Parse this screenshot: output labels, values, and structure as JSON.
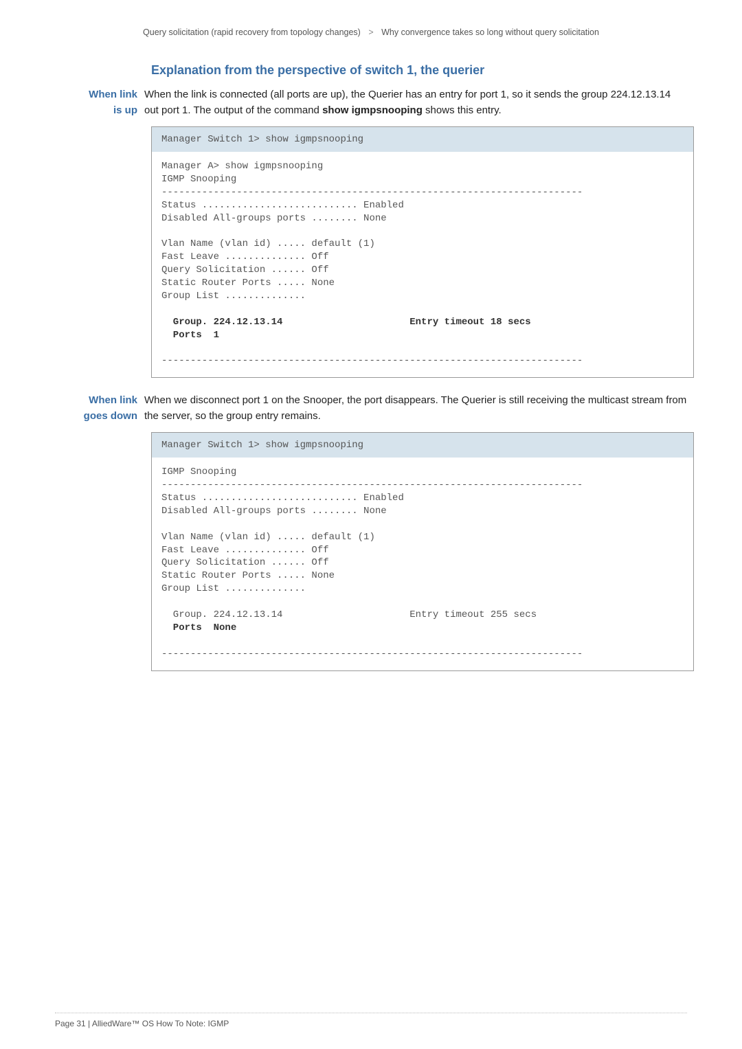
{
  "breadcrumb": {
    "left": "Query solicitation (rapid recovery from topology changes)",
    "right": "Why convergence takes so long without query solicitation"
  },
  "heading": "Explanation from the perspective of switch 1, the querier",
  "section1": {
    "side_l1": "When link",
    "side_l2": "is up",
    "para_a": "When the link is connected (all ports are up), the Querier has an entry for port 1, so it sends the group 224.12.13.14 out port 1. The output of the command ",
    "cmd": "show igmpsnooping",
    "para_b": " shows this entry."
  },
  "term1": {
    "header": "Manager Switch 1> show igmpsnooping",
    "l1": "Manager A> show igmpsnooping",
    "l2": "IGMP Snooping",
    "l3": "-------------------------------------------------------------------------",
    "l4": "Status ........................... Enabled",
    "l5": "Disabled All-groups ports ........ None",
    "l6": "",
    "l7": "Vlan Name (vlan id) ..... default (1)",
    "l8": "Fast Leave .............. Off",
    "l9": "Query Solicitation ...... Off",
    "l10": "Static Router Ports ..... None",
    "l11": "Group List ..............",
    "l12": "",
    "l13": "  Group. 224.12.13.14                      Entry timeout 18 secs",
    "l14": "  Ports  1",
    "l15": "",
    "l16": "-------------------------------------------------------------------------"
  },
  "section2": {
    "side_l1": "When link",
    "side_l2": "goes down",
    "para": "When we disconnect port 1 on the Snooper, the port disappears. The Querier is still receiving the multicast stream from the server, so the group entry remains."
  },
  "term2": {
    "header": "Manager Switch 1> show igmpsnooping",
    "l1": "IGMP Snooping",
    "l2": "-------------------------------------------------------------------------",
    "l3": "Status ........................... Enabled",
    "l4": "Disabled All-groups ports ........ None",
    "l5": "",
    "l6": "Vlan Name (vlan id) ..... default (1)",
    "l7": "Fast Leave .............. Off",
    "l8": "Query Solicitation ...... Off",
    "l9": "Static Router Ports ..... None",
    "l10": "Group List ..............",
    "l11": "",
    "l12a": "  Group. 224.12.13.14                      Entry timeout 255 secs",
    "l12b": "  Ports  None",
    "l13": "",
    "l14": "-------------------------------------------------------------------------"
  },
  "footer": "Page 31 | AlliedWare™ OS How To Note: IGMP"
}
